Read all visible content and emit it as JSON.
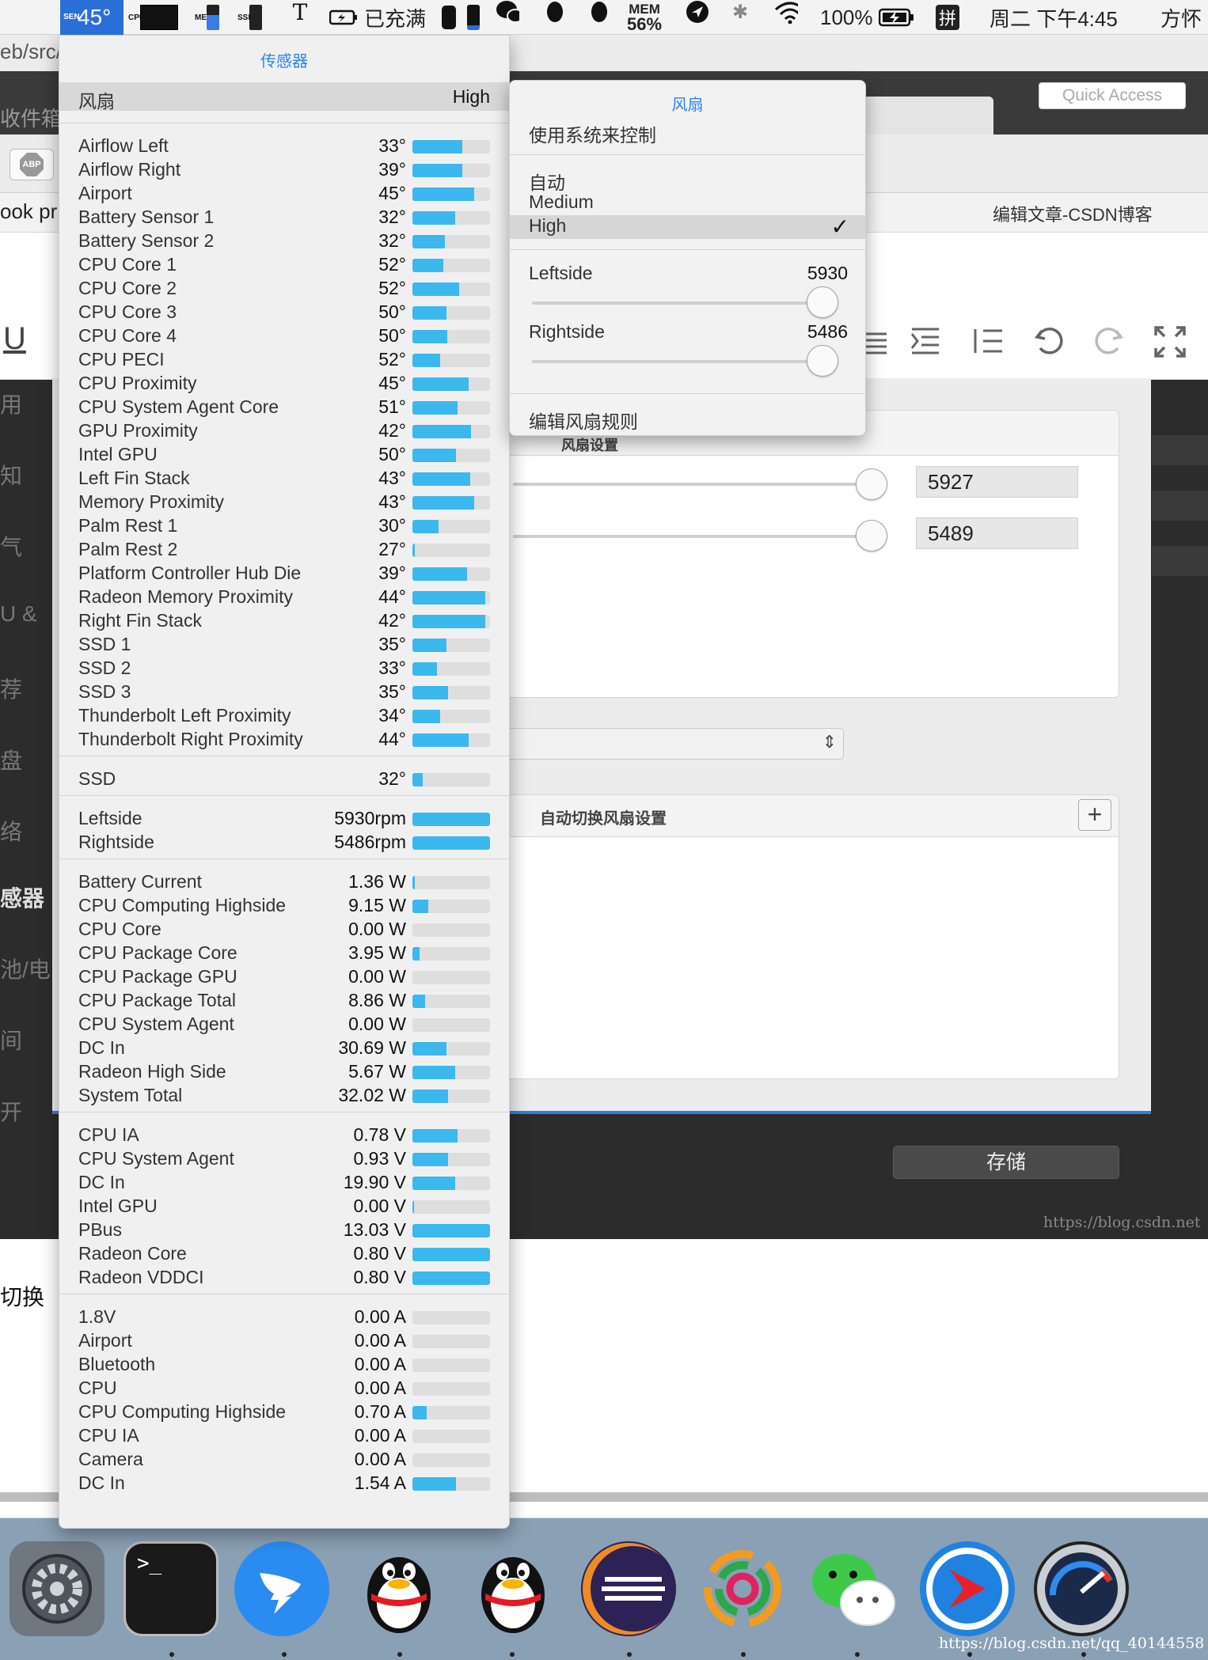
{
  "menubar": {
    "sen_label": "SEN",
    "temperature": "45°",
    "cpu_label": "CPU",
    "mem_short_label": "MEM",
    "ssd_label": "SSD",
    "charge_status": "已充满",
    "mem_label": "MEM",
    "mem_value": "56%",
    "battery_percent": "100%",
    "input_method": "拼",
    "datetime": "周二 下午4:45",
    "user": "方怀"
  },
  "browser": {
    "url_fragment": "eb/src/",
    "inbox_fragment": "收件箱",
    "quick_access_placeholder": "Quick Access",
    "tab_title": "编辑文章-CSDN博客",
    "left_text_fragment": "ook pr",
    "abp_label": "ABP",
    "underline_label": "U",
    "left_bottom_fragment": "切换",
    "sidebar_fragments": [
      "用",
      "知",
      "气",
      "U &",
      "荐",
      "盘",
      "络",
      "感器",
      "池/电",
      "间",
      "开"
    ],
    "watermark_top": "https://blog.csdn.net",
    "watermark_bottom": "https://blog.csdn.net/qq_40144558"
  },
  "prefs": {
    "fan_settings_label": "风扇设置",
    "left_field_value": "5927",
    "right_field_value": "5489",
    "left_slider_level": 0.98,
    "right_slider_level": 0.98,
    "auto_switch_label": "自动切换风扇设置",
    "add_label": "+",
    "save_label": "存储"
  },
  "sensor_menu": {
    "title": "传感器",
    "fan_mode_label": "风扇",
    "fan_mode_value": "High",
    "temperatures": [
      {
        "name": "Airflow Left",
        "value": "33°",
        "level": 0.64
      },
      {
        "name": "Airflow Right",
        "value": "39°",
        "level": 0.64
      },
      {
        "name": "Airport",
        "value": "45°",
        "level": 0.8
      },
      {
        "name": "Battery Sensor 1",
        "value": "32°",
        "level": 0.55
      },
      {
        "name": "Battery Sensor 2",
        "value": "32°",
        "level": 0.42
      },
      {
        "name": "CPU Core 1",
        "value": "52°",
        "level": 0.4
      },
      {
        "name": "CPU Core 2",
        "value": "52°",
        "level": 0.6
      },
      {
        "name": "CPU Core 3",
        "value": "50°",
        "level": 0.44
      },
      {
        "name": "CPU Core 4",
        "value": "50°",
        "level": 0.45
      },
      {
        "name": "CPU PECI",
        "value": "52°",
        "level": 0.36
      },
      {
        "name": "CPU Proximity",
        "value": "45°",
        "level": 0.72
      },
      {
        "name": "CPU System Agent Core",
        "value": "51°",
        "level": 0.58
      },
      {
        "name": "GPU Proximity",
        "value": "42°",
        "level": 0.76
      },
      {
        "name": "Intel GPU",
        "value": "50°",
        "level": 0.56
      },
      {
        "name": "Left Fin Stack",
        "value": "43°",
        "level": 0.74
      },
      {
        "name": "Memory Proximity",
        "value": "43°",
        "level": 0.8
      },
      {
        "name": "Palm Rest 1",
        "value": "30°",
        "level": 0.34
      },
      {
        "name": "Palm Rest 2",
        "value": "27°",
        "level": 0.03
      },
      {
        "name": "Platform Controller Hub Die",
        "value": "39°",
        "level": 0.7
      },
      {
        "name": "Radeon Memory Proximity",
        "value": "44°",
        "level": 0.94
      },
      {
        "name": "Right Fin Stack",
        "value": "42°",
        "level": 0.94
      },
      {
        "name": "SSD 1",
        "value": "35°",
        "level": 0.44
      },
      {
        "name": "SSD 2",
        "value": "33°",
        "level": 0.32
      },
      {
        "name": "SSD 3",
        "value": "35°",
        "level": 0.46
      },
      {
        "name": "Thunderbolt Left Proximity",
        "value": "34°",
        "level": 0.36
      },
      {
        "name": "Thunderbolt Right Proximity",
        "value": "44°",
        "level": 0.72
      }
    ],
    "disks": [
      {
        "name": "SSD",
        "value": "32°",
        "level": 0.13
      }
    ],
    "fans": [
      {
        "name": "Leftside",
        "value": "5930rpm",
        "level": 1.0
      },
      {
        "name": "Rightside",
        "value": "5486rpm",
        "level": 1.0
      }
    ],
    "power": [
      {
        "name": "Battery Current",
        "value": "1.36 W",
        "level": 0.03
      },
      {
        "name": "CPU Computing Highside",
        "value": "9.15 W",
        "level": 0.2
      },
      {
        "name": "CPU Core",
        "value": "0.00 W",
        "level": 0.0
      },
      {
        "name": "CPU Package Core",
        "value": "3.95 W",
        "level": 0.09
      },
      {
        "name": "CPU Package GPU",
        "value": "0.00 W",
        "level": 0.0
      },
      {
        "name": "CPU Package Total",
        "value": "8.86 W",
        "level": 0.16
      },
      {
        "name": "CPU System Agent",
        "value": "0.00 W",
        "level": 0.0
      },
      {
        "name": "DC In",
        "value": "30.69 W",
        "level": 0.44
      },
      {
        "name": "Radeon High Side",
        "value": "5.67 W",
        "level": 0.55
      },
      {
        "name": "System Total",
        "value": "32.02 W",
        "level": 0.46
      }
    ],
    "voltages": [
      {
        "name": "CPU IA",
        "value": "0.78 V",
        "level": 0.58
      },
      {
        "name": "CPU System Agent",
        "value": "0.93 V",
        "level": 0.46
      },
      {
        "name": "DC In",
        "value": "19.90 V",
        "level": 0.55
      },
      {
        "name": "Intel GPU",
        "value": "0.00 V",
        "level": 0.02
      },
      {
        "name": "PBus",
        "value": "13.03 V",
        "level": 1.0
      },
      {
        "name": "Radeon Core",
        "value": "0.80 V",
        "level": 1.0
      },
      {
        "name": "Radeon VDDCI",
        "value": "0.80 V",
        "level": 1.0
      }
    ],
    "currents": [
      {
        "name": "1.8V",
        "value": "0.00 A",
        "level": 0.0
      },
      {
        "name": "Airport",
        "value": "0.00 A",
        "level": 0.0
      },
      {
        "name": "Bluetooth",
        "value": "0.00 A",
        "level": 0.0
      },
      {
        "name": "CPU",
        "value": "0.00 A",
        "level": 0.0
      },
      {
        "name": "CPU Computing Highside",
        "value": "0.70 A",
        "level": 0.18
      },
      {
        "name": "CPU IA",
        "value": "0.00 A",
        "level": 0.0
      },
      {
        "name": "Camera",
        "value": "0.00 A",
        "level": 0.0
      },
      {
        "name": "DC In",
        "value": "1.54 A",
        "level": 0.56
      }
    ]
  },
  "fan_menu": {
    "title": "风扇",
    "system_control": "使用系统来控制",
    "options": [
      "自动",
      "Medium",
      "High"
    ],
    "selected": "High",
    "left_label": "Leftside",
    "left_value": "5930",
    "left_level": 0.98,
    "right_label": "Rightside",
    "right_value": "5486",
    "right_level": 0.98,
    "edit_rules": "编辑风扇规则"
  },
  "dock": {
    "apps": [
      "system-preferences",
      "terminal",
      "dingtalk",
      "qq",
      "qq",
      "eclipse",
      "navicat",
      "wechat",
      "parallels",
      "istat-menus"
    ],
    "terminal_prompt": ">_"
  }
}
